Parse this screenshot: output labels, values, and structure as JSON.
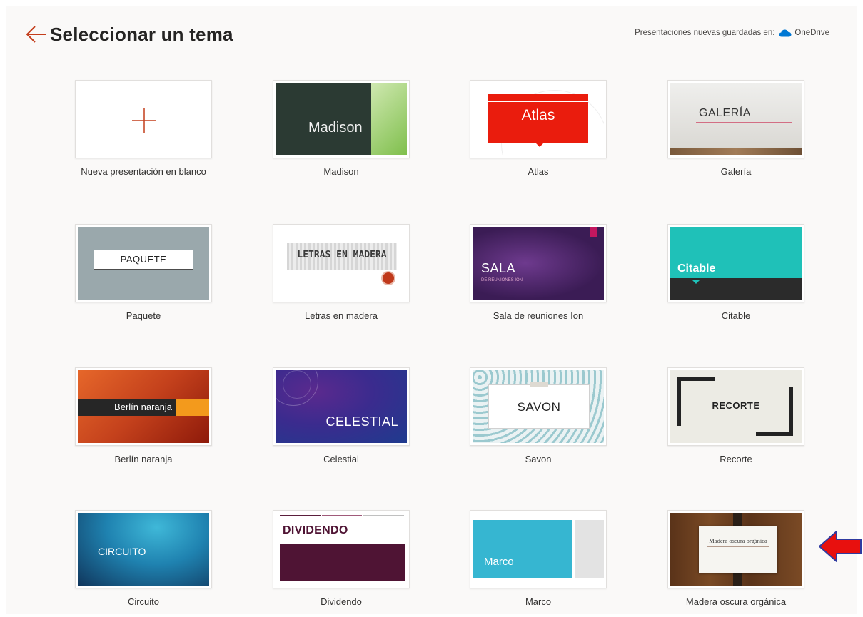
{
  "header": {
    "title": "Seleccionar un tema",
    "save_prefix": "Presentaciones nuevas guardadas en:",
    "save_destination": "OneDrive"
  },
  "themes": [
    {
      "label": "Nueva presentación en blanco"
    },
    {
      "label": "Madison",
      "thumb_text": "Madison"
    },
    {
      "label": "Atlas",
      "thumb_text": "Atlas"
    },
    {
      "label": "Galería",
      "thumb_text": "GALERÍA"
    },
    {
      "label": "Paquete",
      "thumb_text": "PAQUETE"
    },
    {
      "label": "Letras en madera",
      "thumb_text": "LETRAS EN MADERA"
    },
    {
      "label": "Sala de reuniones Ion",
      "thumb_text": "SALA",
      "thumb_sub": "DE REUNIONES ION"
    },
    {
      "label": "Citable",
      "thumb_text": "Citable"
    },
    {
      "label": "Berlín naranja",
      "thumb_text": "Berlín naranja"
    },
    {
      "label": "Celestial",
      "thumb_text": "CELESTIAL"
    },
    {
      "label": "Savon",
      "thumb_text": "SAVON"
    },
    {
      "label": "Recorte",
      "thumb_text": "RECORTE"
    },
    {
      "label": "Circuito",
      "thumb_text": "CIRCUITO"
    },
    {
      "label": "Dividendo",
      "thumb_text": "DIVIDENDO"
    },
    {
      "label": "Marco",
      "thumb_text": "Marco"
    },
    {
      "label": "Madera oscura orgánica",
      "thumb_text": "Madera oscura orgánica"
    }
  ],
  "colors": {
    "accent": "#c43e1c",
    "onedrive": "#0078d4",
    "annotation_arrow": "#e8100e"
  }
}
